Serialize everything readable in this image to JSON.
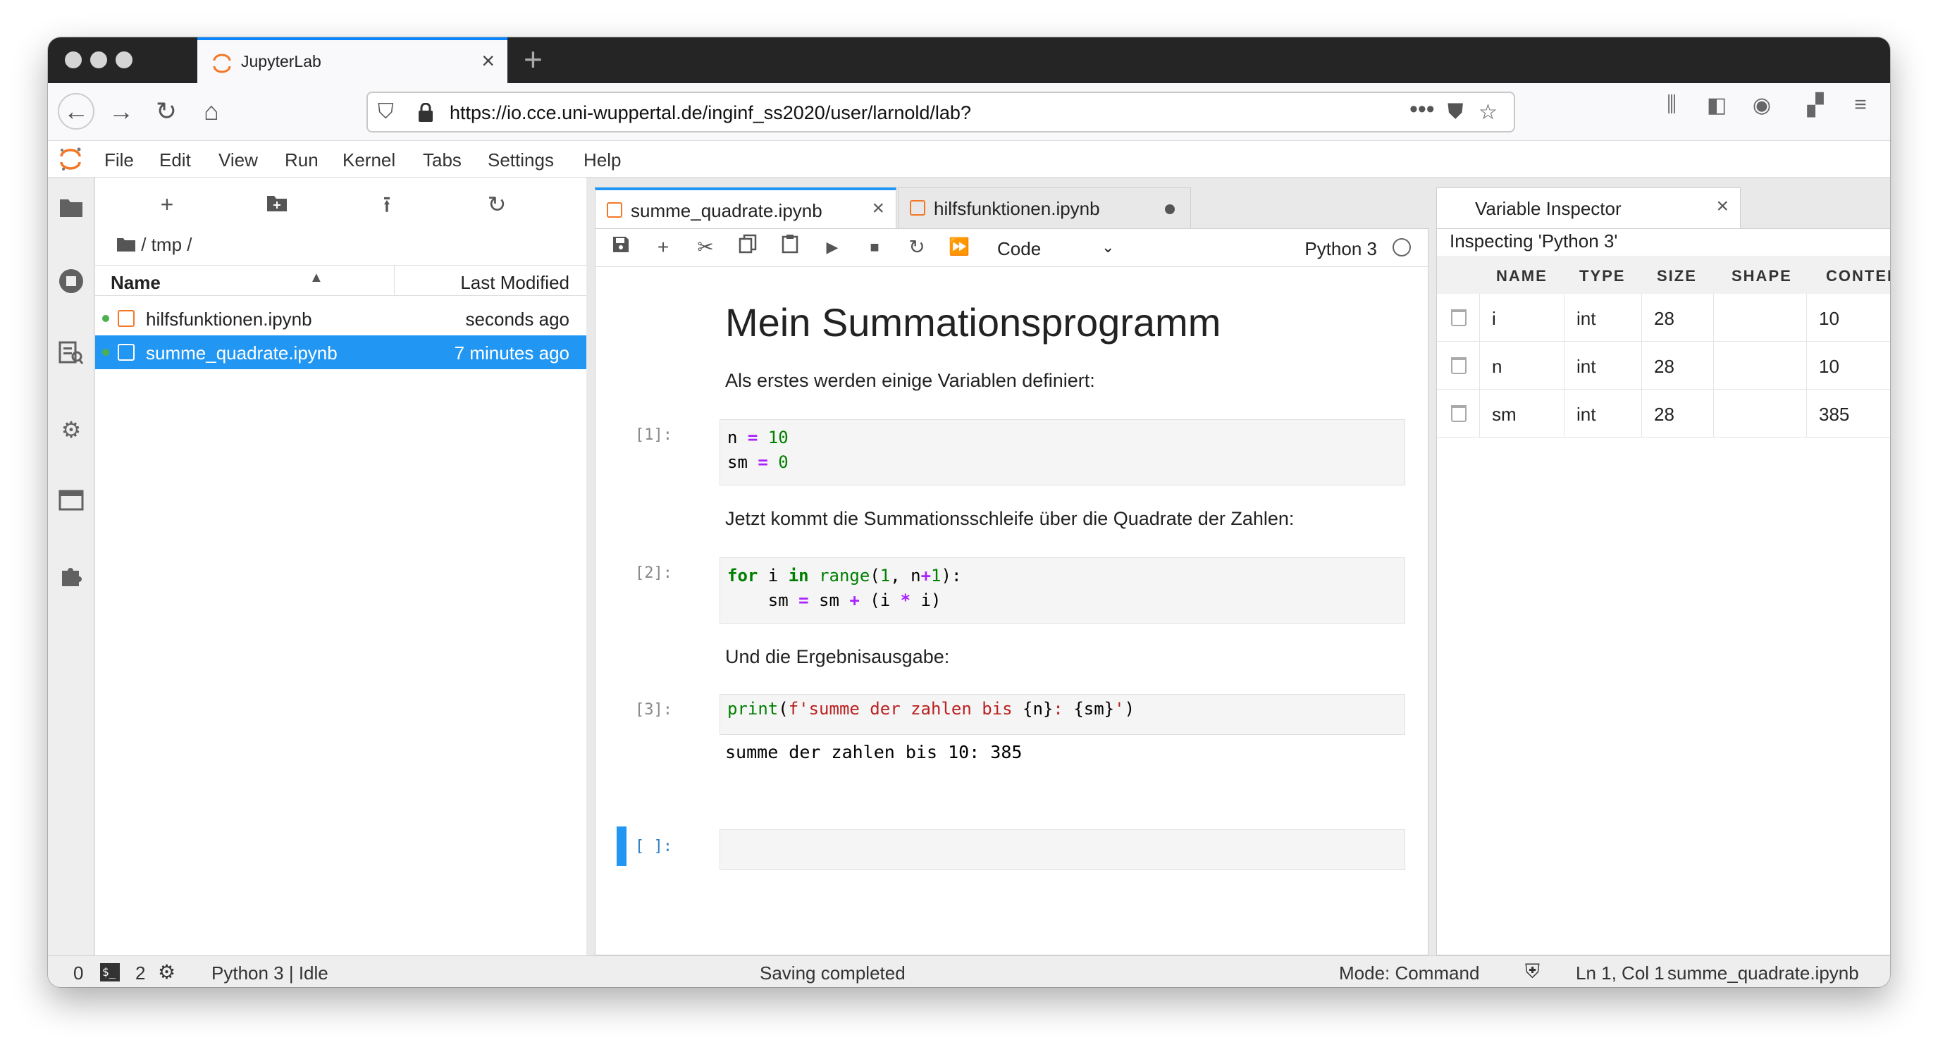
{
  "browser": {
    "tab_title": "JupyterLab",
    "url": "https://io.cce.uni-wuppertal.de/inginf_ss2020/user/larnold/lab?"
  },
  "menu": [
    "File",
    "Edit",
    "View",
    "Run",
    "Kernel",
    "Tabs",
    "Settings",
    "Help"
  ],
  "filebrowser": {
    "breadcrumb": "/ tmp /",
    "col_name": "Name",
    "col_modified": "Last Modified",
    "files": [
      {
        "name": "hilfsfunktionen.ipynb",
        "modified": "seconds ago",
        "selected": false
      },
      {
        "name": "summe_quadrate.ipynb",
        "modified": "7 minutes ago",
        "selected": true
      }
    ]
  },
  "doc_tabs": [
    {
      "label": "summe_quadrate.ipynb",
      "active": true
    },
    {
      "label": "hilfsfunktionen.ipynb",
      "active": false
    }
  ],
  "notebook": {
    "cell_type": "Code",
    "kernel": "Python 3",
    "heading": "Mein Summationsprogramm",
    "md1": "Als erstes werden einige Variablen definiert:",
    "p1": "[1]:",
    "md2": "Jetzt kommt die Summationsschleife über die Quadrate der Zahlen:",
    "p2": "[2]:",
    "md3": "Und die Ergebnisausgabe:",
    "p3": "[3]:",
    "output3": "summe der zahlen bis 10: 385",
    "p4": "[ ]:"
  },
  "inspector": {
    "tab_label": "Variable Inspector",
    "subtitle": "Inspecting 'Python 3'",
    "headers": [
      "NAME",
      "TYPE",
      "SIZE",
      "SHAPE",
      "CONTENT"
    ],
    "rows": [
      {
        "name": "i",
        "type": "int",
        "size": "28",
        "shape": "",
        "content": "10"
      },
      {
        "name": "n",
        "type": "int",
        "size": "28",
        "shape": "",
        "content": "10"
      },
      {
        "name": "sm",
        "type": "int",
        "size": "28",
        "shape": "",
        "content": "385"
      }
    ]
  },
  "status": {
    "terminals": "0",
    "kernels": "2",
    "kernel_state": "Python 3 | Idle",
    "message": "Saving completed",
    "mode": "Mode: Command",
    "position": "Ln 1, Col 1",
    "file": "summe_quadrate.ipynb"
  },
  "colors": {
    "accent": "#2196f3",
    "jupyter_orange": "#f37726",
    "firefox_blue": "#0a84ff"
  }
}
